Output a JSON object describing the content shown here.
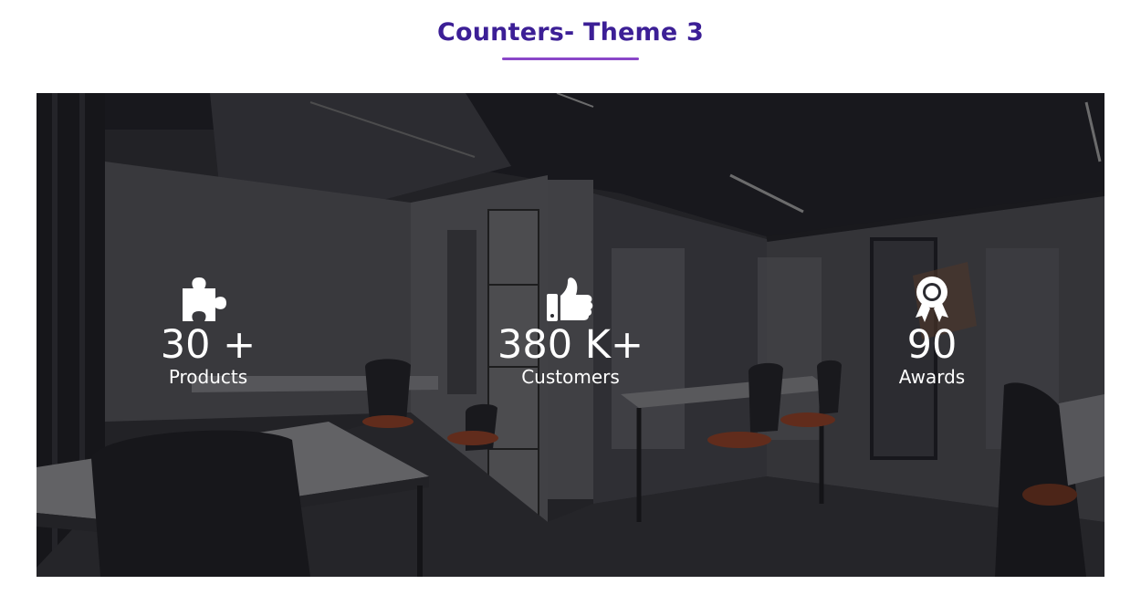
{
  "header": {
    "title": "Counters- Theme 3"
  },
  "colors": {
    "title": "#3c1f96",
    "underline": "#8a46c8",
    "overlay": "#1c1c22",
    "counter_text": "#ffffff"
  },
  "counters": [
    {
      "icon": "puzzle-piece-icon",
      "value": "30 +",
      "label": "Products"
    },
    {
      "icon": "thumbs-up-icon",
      "value": "380 K+",
      "label": "Customers"
    },
    {
      "icon": "award-ribbon-icon",
      "value": "90",
      "label": "Awards"
    }
  ]
}
